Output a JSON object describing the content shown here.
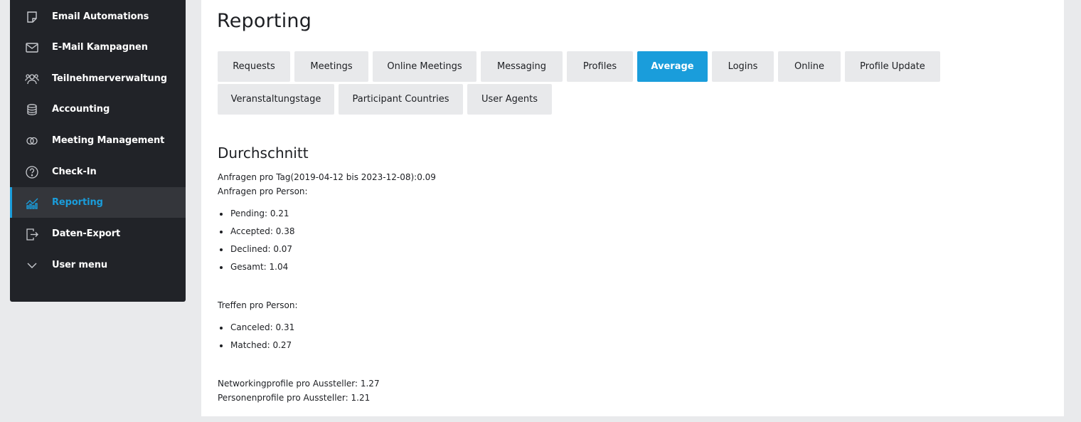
{
  "sidebar": {
    "items": [
      {
        "label": "Email Automations",
        "icon": "note-icon",
        "active": false
      },
      {
        "label": "E-Mail Kampagnen",
        "icon": "envelope-icon",
        "active": false
      },
      {
        "label": "Teilnehmerverwaltung",
        "icon": "users-icon",
        "active": false
      },
      {
        "label": "Accounting",
        "icon": "coins-icon",
        "active": false
      },
      {
        "label": "Meeting Management",
        "icon": "rings-icon",
        "active": false
      },
      {
        "label": "Check-In",
        "icon": "question-circle-icon",
        "active": false
      },
      {
        "label": "Reporting",
        "icon": "chart-icon",
        "active": true
      },
      {
        "label": "Daten-Export",
        "icon": "export-icon",
        "active": false
      },
      {
        "label": "User menu",
        "icon": "chevron-down-icon",
        "active": false
      }
    ],
    "colors": {
      "background": "#212328",
      "active_background": "#34363b",
      "accent": "#1a9ddb"
    }
  },
  "main": {
    "title": "Reporting",
    "tabs": [
      {
        "label": "Requests",
        "active": false
      },
      {
        "label": "Meetings",
        "active": false
      },
      {
        "label": "Online Meetings",
        "active": false
      },
      {
        "label": "Messaging",
        "active": false
      },
      {
        "label": "Profiles",
        "active": false
      },
      {
        "label": "Average",
        "active": true
      },
      {
        "label": "Logins",
        "active": false
      },
      {
        "label": "Online",
        "active": false
      },
      {
        "label": "Profile Update",
        "active": false
      },
      {
        "label": "Veranstaltungstage",
        "active": false
      },
      {
        "label": "Participant Countries",
        "active": false
      },
      {
        "label": "User Agents",
        "active": false
      }
    ],
    "section_title": "Durchschnitt",
    "requests_per_day": "Anfragen pro Tag(2019-04-12 bis 2023-12-08):0.09",
    "requests_per_person_label": "Anfragen pro Person:",
    "requests_per_person": [
      "Pending: 0.21",
      "Accepted: 0.38",
      "Declined: 0.07",
      "Gesamt: 1.04"
    ],
    "meetings_per_person_label": "Treffen pro Person:",
    "meetings_per_person": [
      "Canceled: 0.31",
      "Matched: 0.27"
    ],
    "networking_profiles_per_exhibitor": "Networkingprofile pro Aussteller: 1.27",
    "person_profiles_per_exhibitor": "Personenprofile pro Aussteller: 1.21"
  }
}
